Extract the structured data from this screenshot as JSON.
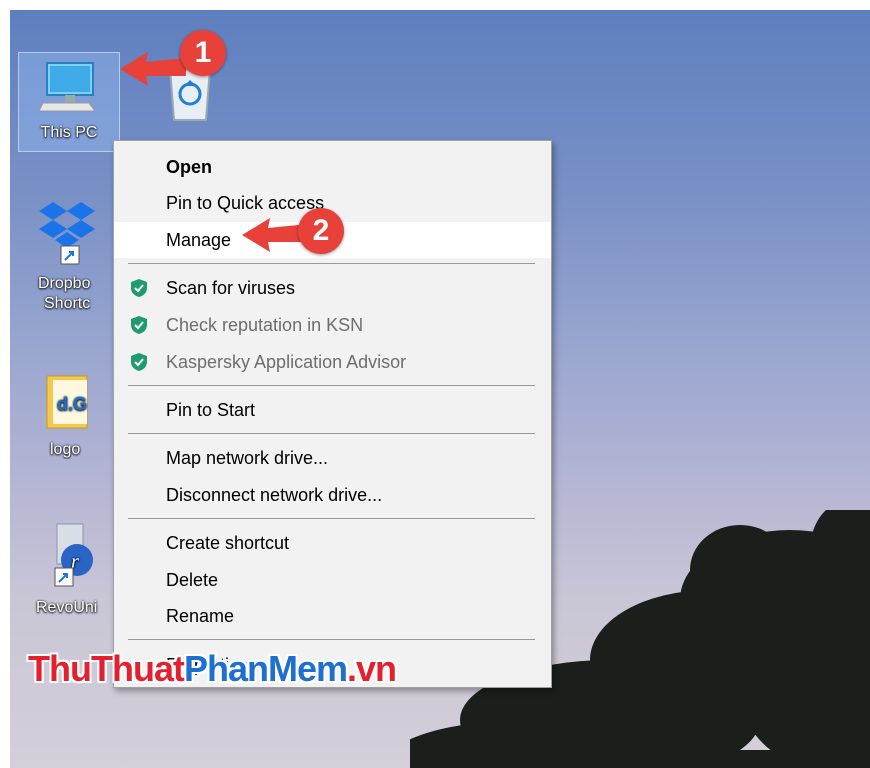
{
  "desktop_icons": [
    {
      "label": "This PC",
      "icon": "monitor-icon"
    },
    {
      "label": "",
      "icon": "recycle-bin-icon"
    },
    {
      "label": "Dropbox Shortcut",
      "line1": "Dropbo",
      "line2": "Shortc",
      "icon": "dropbox-icon"
    },
    {
      "label": "logo",
      "icon": "folder-icon"
    },
    {
      "label": "RevoUni",
      "icon": "revo-uninstaller-icon"
    }
  ],
  "context_menu": {
    "items": [
      {
        "label": "Open",
        "bold": true
      },
      {
        "label": "Pin to Quick access"
      },
      {
        "label": "Manage",
        "highlighted": true
      },
      {
        "label": "Scan for viruses",
        "icon": "kaspersky-shield-icon"
      },
      {
        "label": "Check reputation in KSN",
        "icon": "kaspersky-shield-icon",
        "disabled": true
      },
      {
        "label": "Kaspersky Application Advisor",
        "icon": "kaspersky-shield-icon",
        "disabled": true
      },
      {
        "label": "Pin to Start"
      },
      {
        "label": "Map network drive..."
      },
      {
        "label": "Disconnect network drive..."
      },
      {
        "label": "Create shortcut"
      },
      {
        "label": "Delete"
      },
      {
        "label": "Rename"
      },
      {
        "label": "Properties"
      }
    ]
  },
  "annotations": {
    "step1": "1",
    "step2": "2"
  },
  "watermark": {
    "part1": "ThuThuat",
    "part2": "PhanMem",
    "part3": ".vn"
  },
  "colors": {
    "annotation_red": "#e8413a",
    "kaspersky_green": "#1e9c6e",
    "watermark_red": "#e5202e",
    "watermark_blue": "#1d6fd0"
  }
}
